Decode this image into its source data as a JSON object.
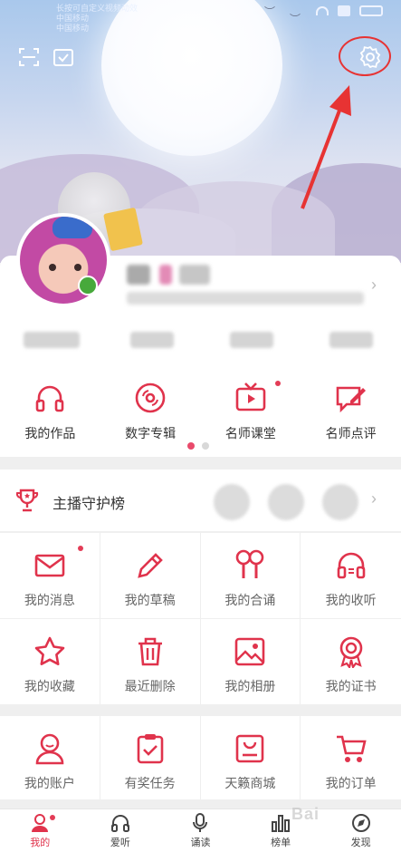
{
  "status_bar": {
    "carrier_lines": [
      "长按可自定义视频动效",
      "中国移动",
      "中国移动"
    ],
    "battery": ""
  },
  "header": {
    "scan_icon": "scan-icon",
    "checkin_icon": "checkin-icon",
    "settings_icon": "gear-icon",
    "annotation_color": "#e73333"
  },
  "profile": {
    "name": "",
    "subtitle": "",
    "stats": []
  },
  "features": [
    {
      "label": "我的作品",
      "icon": "headphones-icon",
      "badge": false
    },
    {
      "label": "数字专辑",
      "icon": "disc-icon",
      "badge": false
    },
    {
      "label": "名师课堂",
      "icon": "tv-play-icon",
      "badge": true
    },
    {
      "label": "名师点评",
      "icon": "comment-edit-icon",
      "badge": false
    }
  ],
  "pager": {
    "current": 1,
    "total": 2
  },
  "rank": {
    "title": "主播守护榜"
  },
  "grid": [
    {
      "label": "我的消息",
      "icon": "mail-icon",
      "badge": true
    },
    {
      "label": "我的草稿",
      "icon": "pencil-icon",
      "badge": false
    },
    {
      "label": "我的合诵",
      "icon": "duet-mic-icon",
      "badge": false
    },
    {
      "label": "我的收听",
      "icon": "listen-icon",
      "badge": false
    },
    {
      "label": "我的收藏",
      "icon": "star-icon",
      "badge": false
    },
    {
      "label": "最近删除",
      "icon": "trash-icon",
      "badge": false
    },
    {
      "label": "我的相册",
      "icon": "photo-icon",
      "badge": false
    },
    {
      "label": "我的证书",
      "icon": "certificate-icon",
      "badge": false
    }
  ],
  "grid2": [
    {
      "label": "我的账户",
      "icon": "user-icon"
    },
    {
      "label": "有奖任务",
      "icon": "clipboard-check-icon"
    },
    {
      "label": "天籁商城",
      "icon": "shop-icon"
    },
    {
      "label": "我的订单",
      "icon": "cart-icon"
    }
  ],
  "tabs": [
    {
      "label": "我的",
      "icon": "profile-icon",
      "active": true,
      "badge": true
    },
    {
      "label": "爱听",
      "icon": "headset-icon",
      "active": false,
      "badge": false
    },
    {
      "label": "诵读",
      "icon": "microphone-icon",
      "active": false,
      "badge": false
    },
    {
      "label": "榜单",
      "icon": "bar-chart-icon",
      "active": false,
      "badge": false
    },
    {
      "label": "发现",
      "icon": "compass-icon",
      "active": false,
      "badge": false
    }
  ],
  "colors": {
    "accent": "#e0334c",
    "annotation": "#e73333"
  },
  "watermark": "Bai"
}
